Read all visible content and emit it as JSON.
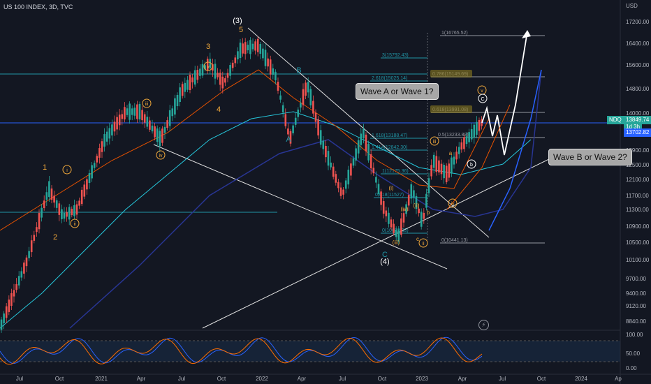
{
  "header": {
    "title": "US 100 INDEX, 3D, TVC",
    "currency": "USD"
  },
  "price_boxes": {
    "symbol": "NDQ",
    "last_price": "13849.74",
    "countdown": "1d 3h",
    "level_price": "13702.82"
  },
  "price_axis": [
    "17200.00",
    "16400.00",
    "15600.00",
    "14800.00",
    "14000.00",
    "12900.00",
    "12500.00",
    "12100.00",
    "11700.00",
    "11300.00",
    "10900.00",
    "10500.00",
    "10100.00",
    "9700.00",
    "9400.00",
    "9120.00",
    "8840.00"
  ],
  "oscillator_axis": [
    "100.00",
    "50.00",
    "0.00"
  ],
  "time_axis": [
    "Jul",
    "Oct",
    "2021",
    "Apr",
    "Jul",
    "Oct",
    "2022",
    "Apr",
    "Jul",
    "Oct",
    "2023",
    "Apr",
    "Jul",
    "Oct",
    "2024",
    "Ap"
  ],
  "fib_levels": [
    {
      "label": "1(16765.52)"
    },
    {
      "label": "3(15792.43)"
    },
    {
      "label": "2.618(15025.14)"
    },
    {
      "label": "0.786(15149.69)"
    },
    {
      "label": "0.618(13991.08)"
    },
    {
      "label": "0.5(13233.89)"
    },
    {
      "label": "1.618(13188.47)"
    },
    {
      "label": "1.414(12842.30)"
    },
    {
      "label": "1(12175.36)"
    },
    {
      "label": "0.618(11527)"
    },
    {
      "label": "0(10682.33)"
    },
    {
      "label": "0(10441.13)"
    }
  ],
  "wave_labels": {
    "wave_3_paren": "(3)",
    "wave_5": "5",
    "wave_3": "3",
    "wave_4": "4",
    "wave_1": "1",
    "wave_2": "2",
    "wave_4_paren": "(4)",
    "wave_c": "C",
    "wave_b": "B",
    "wave_a": "A",
    "sub_i": "i",
    "sub_ii": "ii",
    "sub_iii": "iii",
    "sub_iv": "iv",
    "sub_v": "v",
    "circ_a": "a",
    "circ_b": "b",
    "circ_c": "c",
    "wave_c_circled": "C",
    "wave_v_circled": "v"
  },
  "callouts": {
    "wave_a": "Wave A or Wave 1?",
    "wave_b": "Wave B or Wave 2?"
  },
  "colors": {
    "background": "#131722",
    "candle_up": "#26a69a",
    "candle_down": "#ef5350",
    "wave_label": "#f2a93b",
    "fib_teal": "#2196a6",
    "price_box_teal": "#26a69a",
    "price_box_blue": "#2962ff"
  }
}
